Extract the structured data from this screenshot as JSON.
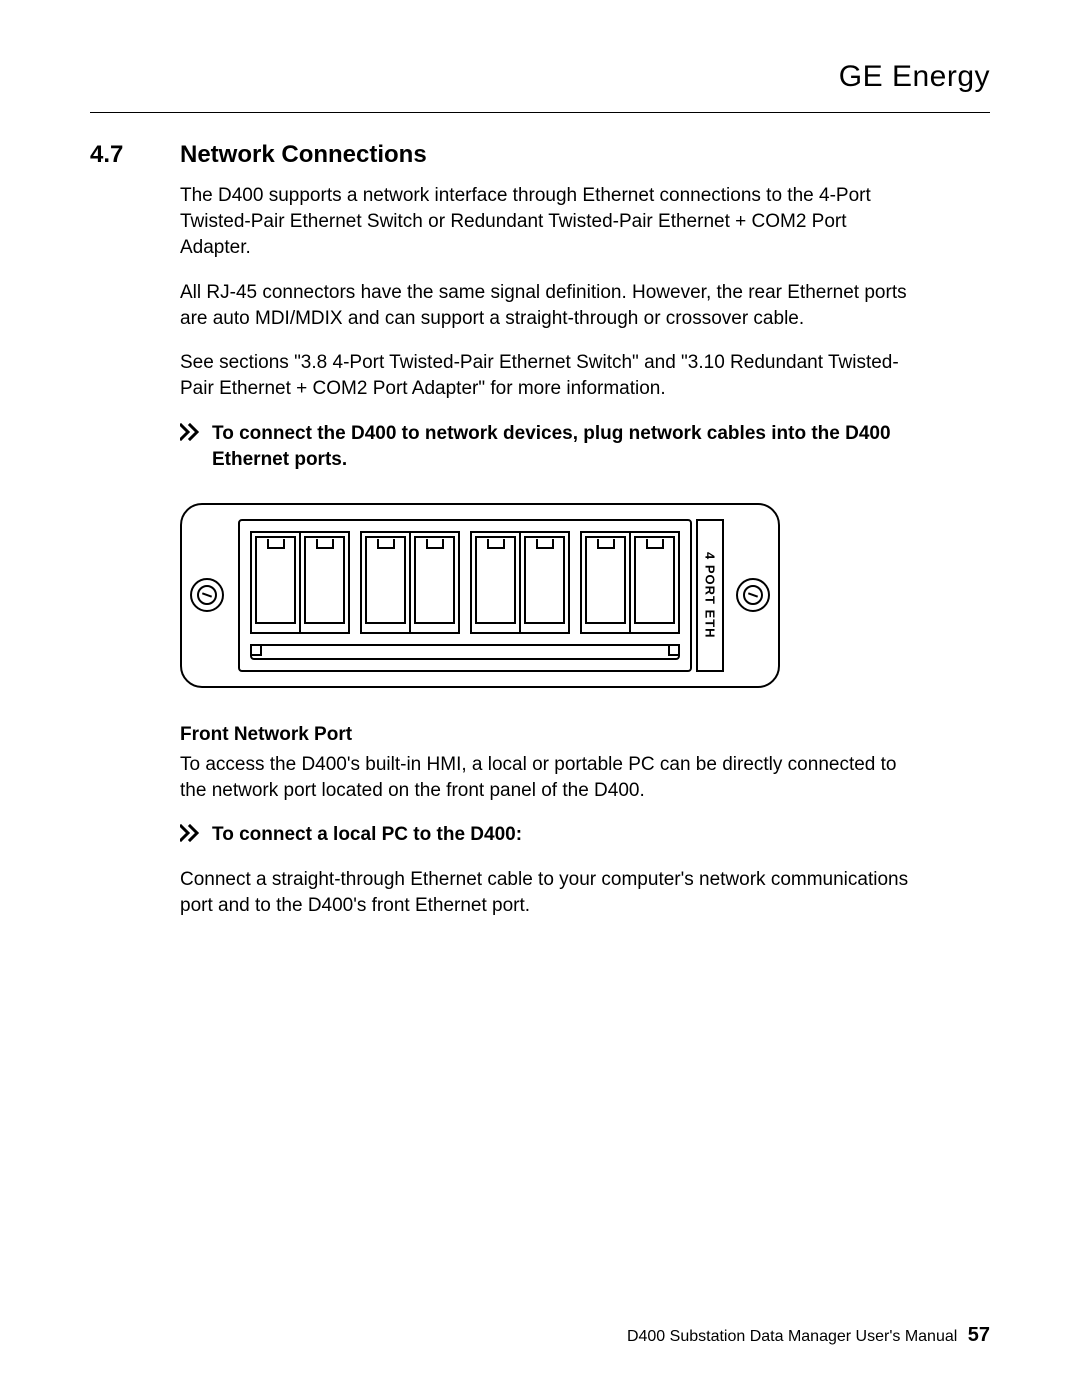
{
  "header": {
    "brand": "GE Energy"
  },
  "section": {
    "number": "4.7",
    "title": "Network Connections"
  },
  "paragraphs": {
    "p1": "The D400 supports a network interface through Ethernet connections to the 4-Port Twisted-Pair Ethernet Switch or Redundant Twisted-Pair Ethernet + COM2 Port Adapter.",
    "p2": "All RJ-45 connectors have the same signal definition. However, the rear Ethernet ports are auto MDI/MDIX and can support a straight-through or crossover cable.",
    "p3": "See sections \"3.8 4-Port Twisted-Pair Ethernet Switch\" and \"3.10 Redundant Twisted-Pair Ethernet + COM2 Port Adapter\" for more information."
  },
  "action1": "To connect the D400 to network devices, plug network cables into the D400 Ethernet ports.",
  "figure": {
    "device_label": "4 PORT ETH"
  },
  "subhead1": "Front Network Port",
  "paragraph4": "To access the D400's built-in HMI, a local or portable PC can be directly connected to the network port located on the front panel of the D400.",
  "action2": "To connect a local PC to the D400:",
  "paragraph5": "Connect a straight-through Ethernet cable to your computer's network communications port and to the D400's front Ethernet port.",
  "footer": {
    "doc_title": "D400 Substation Data Manager User's Manual",
    "page_number": "57"
  }
}
